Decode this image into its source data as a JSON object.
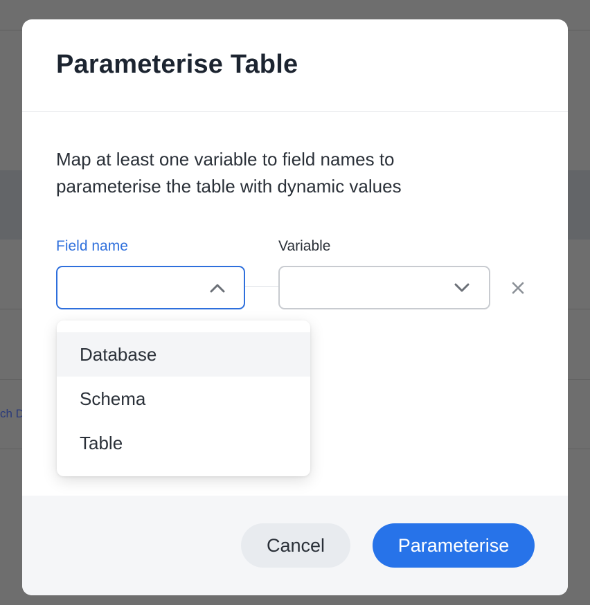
{
  "background": {
    "partial_link_text": "ch D"
  },
  "modal": {
    "title": "Parameterise Table",
    "description": "Map at least one variable to field names to parameterise the table with dynamic values",
    "field_name_label": "Field name",
    "variable_label": "Variable",
    "field_name_value": "",
    "variable_value": "",
    "dropdown_options": [
      {
        "label": "Database",
        "highlighted": true
      },
      {
        "label": "Schema",
        "highlighted": false
      },
      {
        "label": "Table",
        "highlighted": false
      }
    ],
    "footer": {
      "cancel_label": "Cancel",
      "primary_label": "Parameterise"
    }
  },
  "icons": {
    "field_select": "chevron-up-icon",
    "variable_select": "chevron-down-icon",
    "remove": "close-icon"
  },
  "colors": {
    "accent": "#2773e9",
    "focus_border": "#2e6fdc",
    "overlay": "#6e6e6e"
  }
}
